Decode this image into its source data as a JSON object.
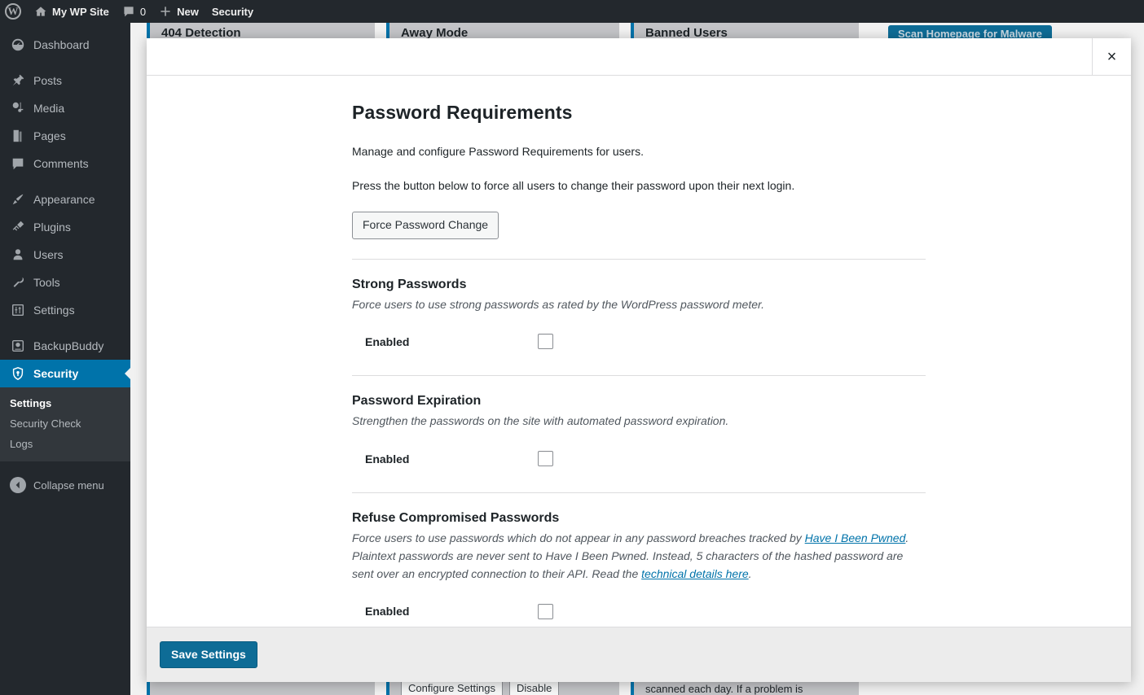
{
  "adminbar": {
    "logo_icon": "wordpress-logo-icon",
    "site_icon": "home-icon",
    "site_name": "My WP Site",
    "comments_icon": "comment-bubble-icon",
    "comments_count": "0",
    "new_icon": "plus-icon",
    "new_label": "New",
    "security_label": "Security"
  },
  "sidebar": {
    "items": [
      {
        "label": "Dashboard",
        "icon": "dashboard-icon",
        "current": false
      },
      {
        "label": "Posts",
        "icon": "pin-icon",
        "current": false
      },
      {
        "label": "Media",
        "icon": "media-icon",
        "current": false
      },
      {
        "label": "Pages",
        "icon": "pages-icon",
        "current": false
      },
      {
        "label": "Comments",
        "icon": "comment-bubble-icon",
        "current": false
      },
      {
        "label": "Appearance",
        "icon": "paintbrush-icon",
        "current": false
      },
      {
        "label": "Plugins",
        "icon": "plug-icon",
        "current": false
      },
      {
        "label": "Users",
        "icon": "user-icon",
        "current": false
      },
      {
        "label": "Tools",
        "icon": "wrench-icon",
        "current": false
      },
      {
        "label": "Settings",
        "icon": "sliders-icon",
        "current": false
      },
      {
        "label": "BackupBuddy",
        "icon": "backup-drive-icon",
        "current": false
      },
      {
        "label": "Security",
        "icon": "shield-icon",
        "current": true
      }
    ],
    "submenu": [
      {
        "label": "Settings",
        "current": true
      },
      {
        "label": "Security Check",
        "current": false
      },
      {
        "label": "Logs",
        "current": false
      }
    ],
    "collapse_label": "Collapse menu",
    "collapse_icon": "chevron-left-circle-icon",
    "active_color": "#0073aa"
  },
  "background": {
    "cards": [
      "404 Detection",
      "Away Mode",
      "Banned Users"
    ],
    "scan_button": "Scan Homepage for Malware",
    "bottom_buttons": [
      "Configure Settings",
      "Disable"
    ],
    "bottom_text": "scanned each day. If a problem is"
  },
  "modal": {
    "close_icon": "close-icon",
    "close_label": "×",
    "title": "Password Requirements",
    "intro_1": "Manage and configure Password Requirements for users.",
    "intro_2": "Press the button below to force all users to change their password upon their next login.",
    "force_button": "Force Password Change",
    "sections": [
      {
        "title": "Strong Passwords",
        "desc": "Force users to use strong passwords as rated by the WordPress password meter.",
        "enabled_label": "Enabled",
        "checked": false
      },
      {
        "title": "Password Expiration",
        "desc": "Strengthen the passwords on the site with automated password expiration.",
        "enabled_label": "Enabled",
        "checked": false
      },
      {
        "title": "Refuse Compromised Passwords",
        "desc_part_1": "Force users to use passwords which do not appear in any password breaches tracked by ",
        "link_1": "Have I Been Pwned",
        "desc_part_2": ". Plaintext passwords are never sent to Have I Been Pwned. Instead, 5 characters of the hashed password are sent over an encrypted connection to their API. Read the ",
        "link_2": "technical details here",
        "desc_part_3": ".",
        "enabled_label": "Enabled",
        "checked": false
      }
    ],
    "save_button": "Save Settings",
    "primary_color": "#0e6c96"
  }
}
